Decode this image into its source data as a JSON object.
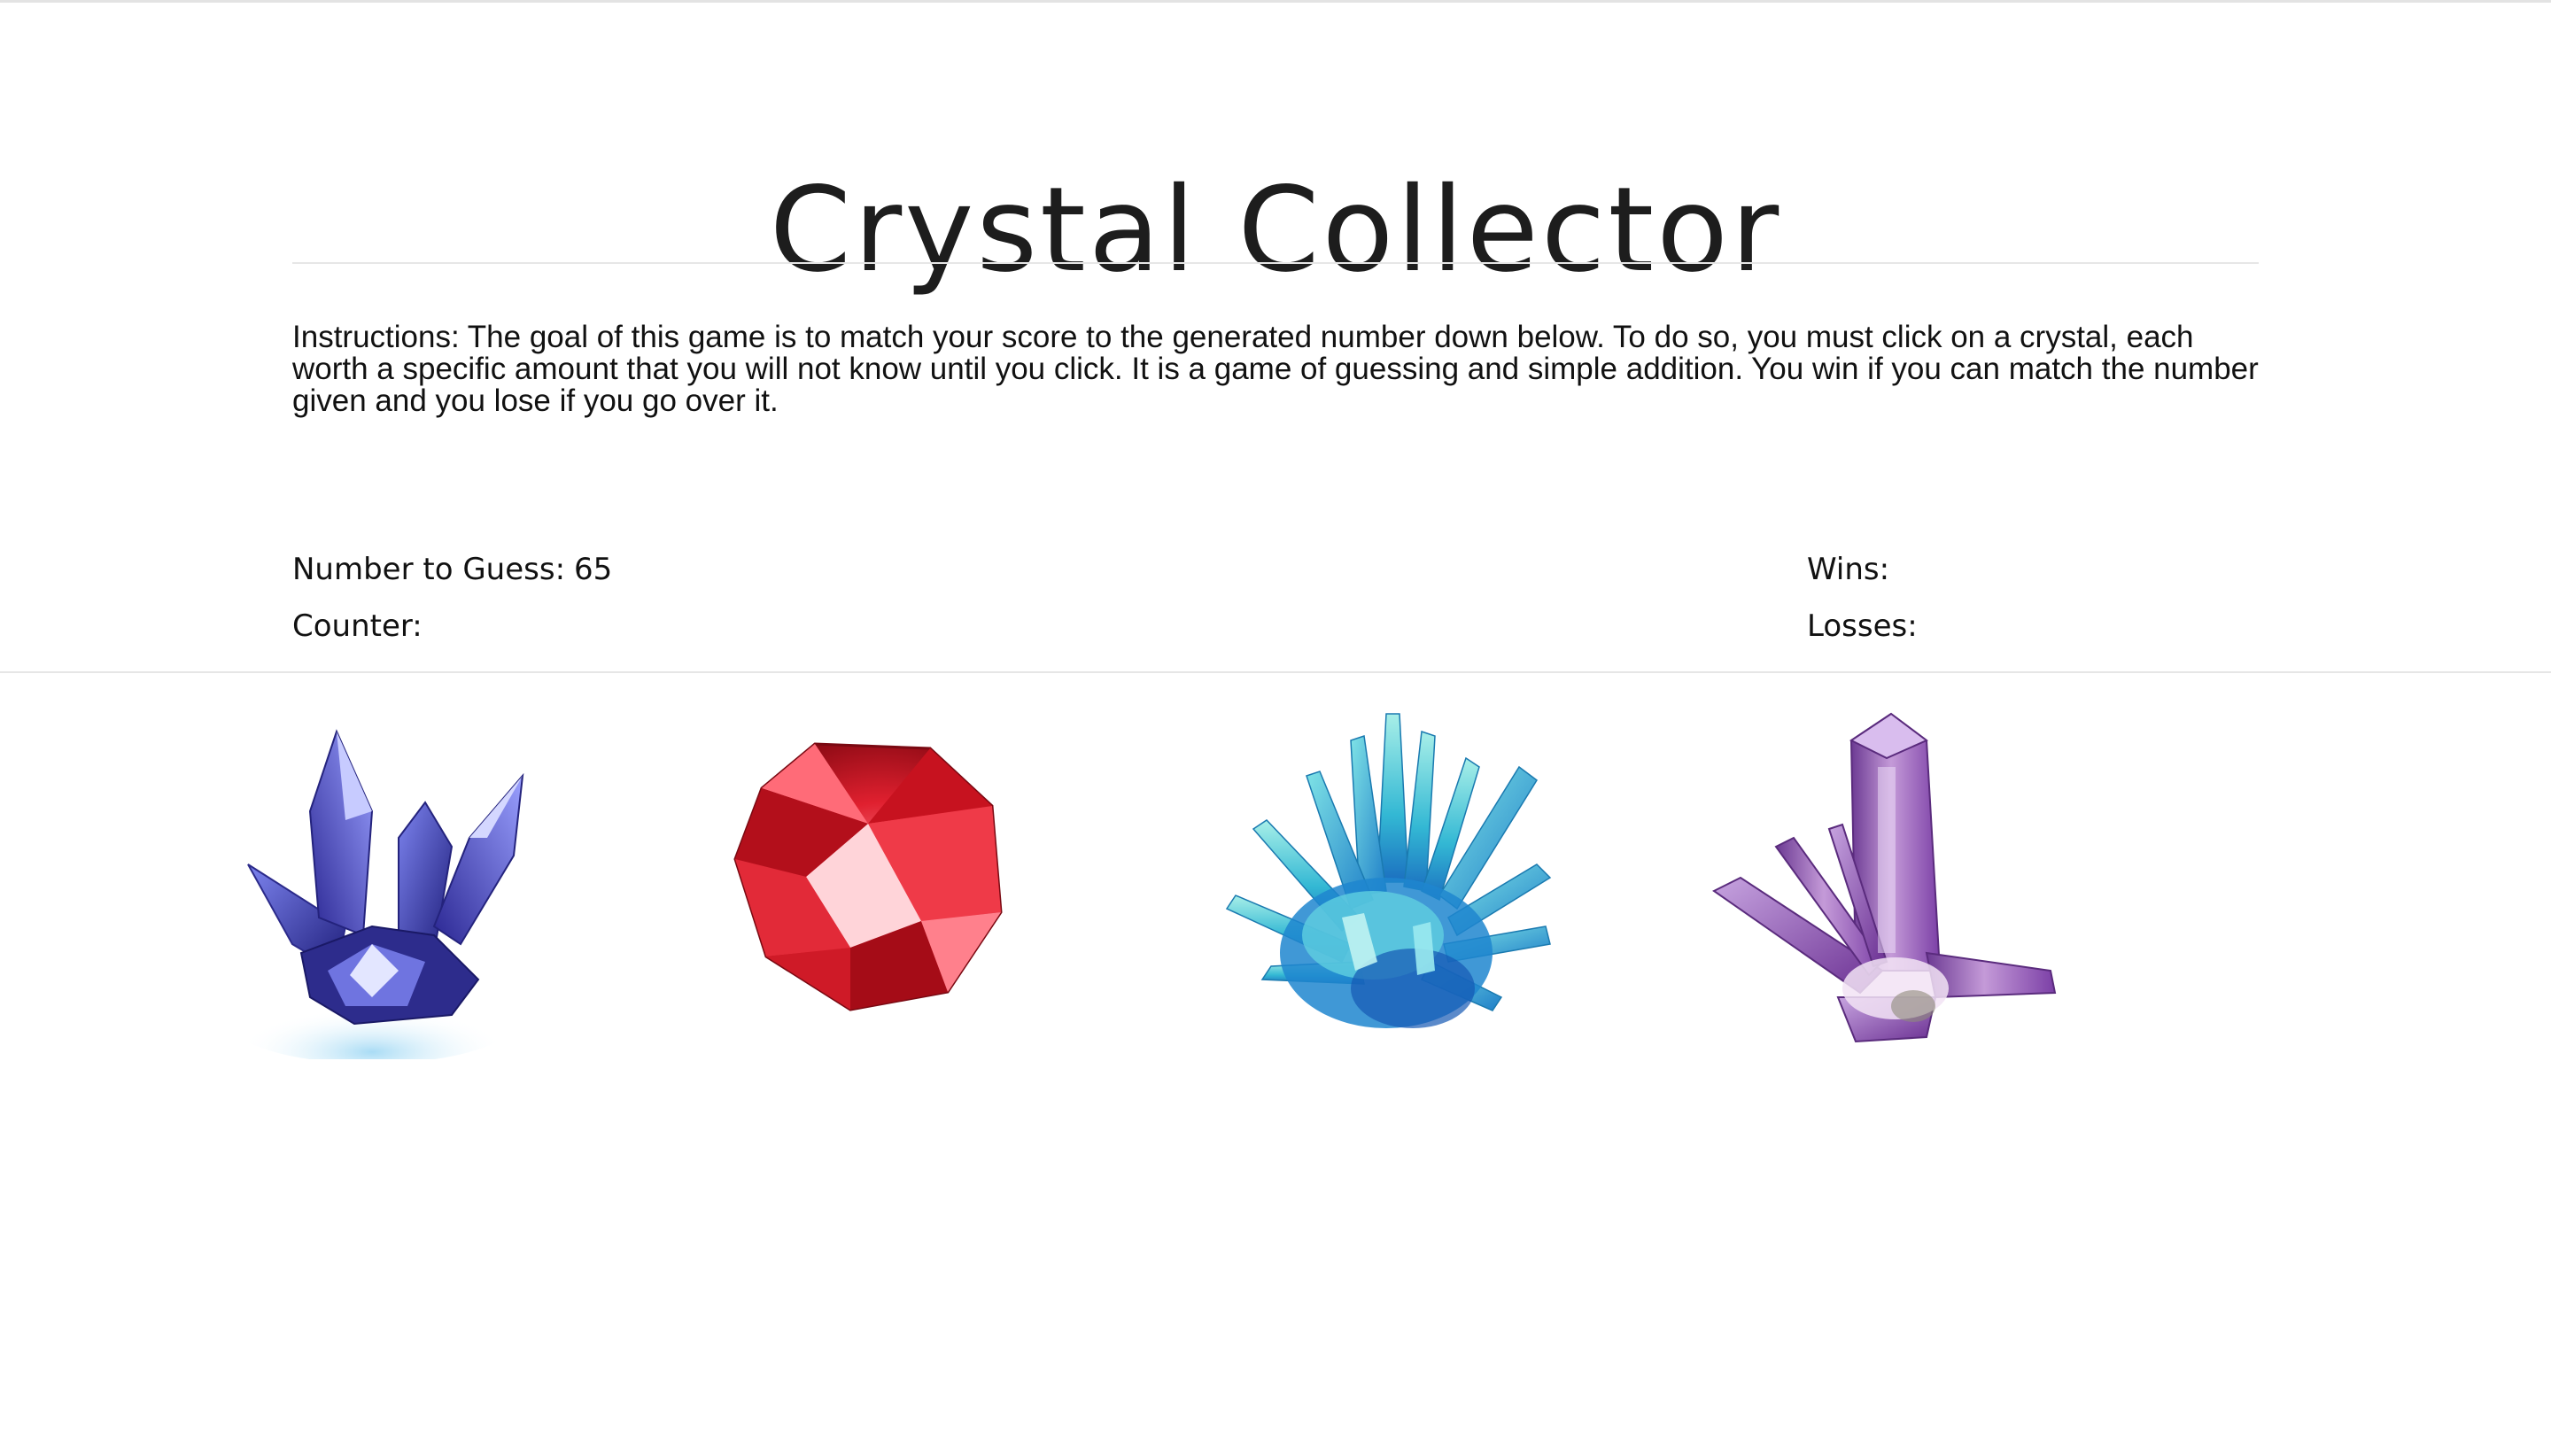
{
  "game": {
    "title": "Crystal Collector",
    "instructions": "Instructions: The goal of this game is to match your score to the generated number down below. To do so, you must click on a crystal, each worth a specific amount that you will not know until you click. It is a game of guessing and simple addition. You win if you can match the number given and you lose if you go over it."
  },
  "stats": {
    "guess_label": "Number to Guess:",
    "guess_value": "65",
    "counter_label": "Counter:",
    "counter_value": "",
    "wins_label": "Wins:",
    "wins_value": "",
    "losses_label": "Losses:",
    "losses_value": ""
  },
  "crystals": [
    {
      "name": "blue-crystal-cluster",
      "color": "#3b3fb8"
    },
    {
      "name": "red-gem",
      "color": "#d61f2b"
    },
    {
      "name": "cyan-crystal-cluster",
      "color": "#2fb8d6"
    },
    {
      "name": "purple-amethyst",
      "color": "#9a5fc0"
    }
  ]
}
